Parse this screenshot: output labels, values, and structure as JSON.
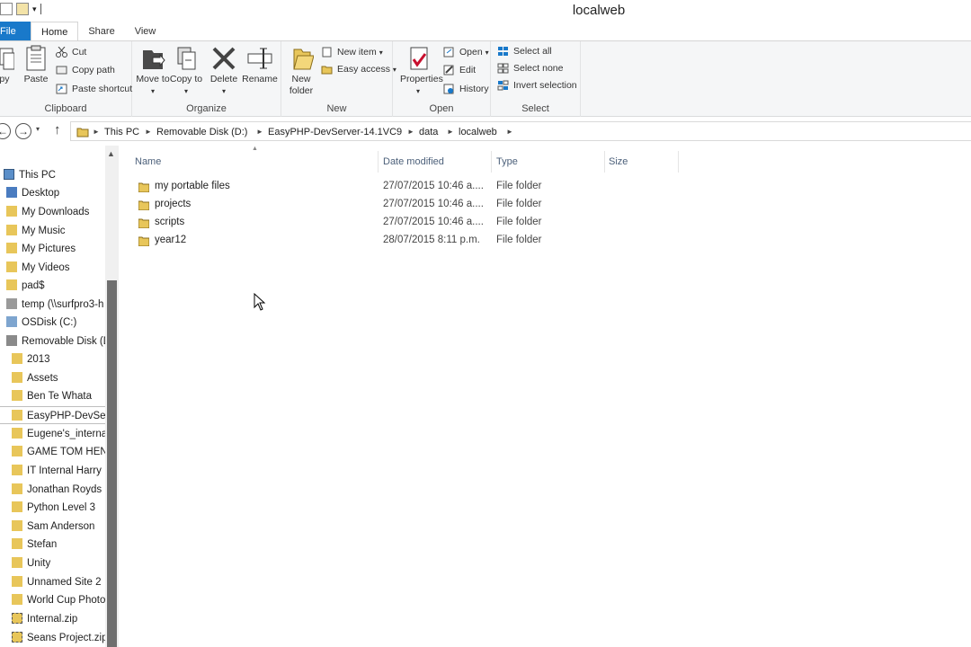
{
  "window": {
    "title": "localweb"
  },
  "tabs": [
    "File",
    "Home",
    "Share",
    "View"
  ],
  "ribbon": {
    "clipboard": {
      "label": "Clipboard",
      "copy": "opy",
      "paste": "Paste",
      "cut": "Cut",
      "copy_path": "Copy path",
      "paste_shortcut": "Paste shortcut"
    },
    "organize": {
      "label": "Organize",
      "move_to": "Move to",
      "copy_to": "Copy to",
      "delete": "Delete",
      "rename": "Rename"
    },
    "new": {
      "label": "New",
      "new_folder": "New folder",
      "new_item": "New item",
      "easy_access": "Easy access"
    },
    "open": {
      "label": "Open",
      "properties": "Properties",
      "open": "Open",
      "edit": "Edit",
      "history": "History"
    },
    "select": {
      "label": "Select",
      "select_all": "Select all",
      "select_none": "Select none",
      "invert_selection": "Invert selection"
    }
  },
  "address": {
    "crumbs": [
      "This PC",
      "Removable Disk (D:)",
      "EasyPHP-DevServer-14.1VC9",
      "data",
      "localweb"
    ]
  },
  "nav": {
    "items": [
      "This PC",
      "Desktop",
      "My Downloads",
      "My Music",
      "My Pictures",
      "My Videos",
      "pad$",
      "temp (\\\\surfpro3-h",
      "OSDisk (C:)",
      "Removable Disk (D",
      "2013",
      "Assets",
      "Ben Te Whata",
      "EasyPHP-DevServ",
      "Eugene's_interna",
      "GAME TOM HEN",
      "IT Internal Harry",
      "Jonathan Royds",
      "Python Level 3",
      "Sam Anderson",
      "Stefan",
      "Unity",
      "Unnamed Site 2",
      "World Cup Photo",
      "Internal.zip",
      "Seans Project.zip"
    ]
  },
  "columns": {
    "name": "Name",
    "date": "Date modified",
    "type": "Type",
    "size": "Size"
  },
  "files": [
    {
      "name": "my portable files",
      "date": "27/07/2015 10:46 a....",
      "type": "File folder"
    },
    {
      "name": "projects",
      "date": "27/07/2015 10:46 a....",
      "type": "File folder"
    },
    {
      "name": "scripts",
      "date": "27/07/2015 10:46 a....",
      "type": "File folder"
    },
    {
      "name": "year12",
      "date": "28/07/2015 8:11 p.m.",
      "type": "File folder"
    }
  ],
  "colors": {
    "accent": "#1979ca",
    "folder": "#e8c65a",
    "header_text": "#4c607a"
  }
}
